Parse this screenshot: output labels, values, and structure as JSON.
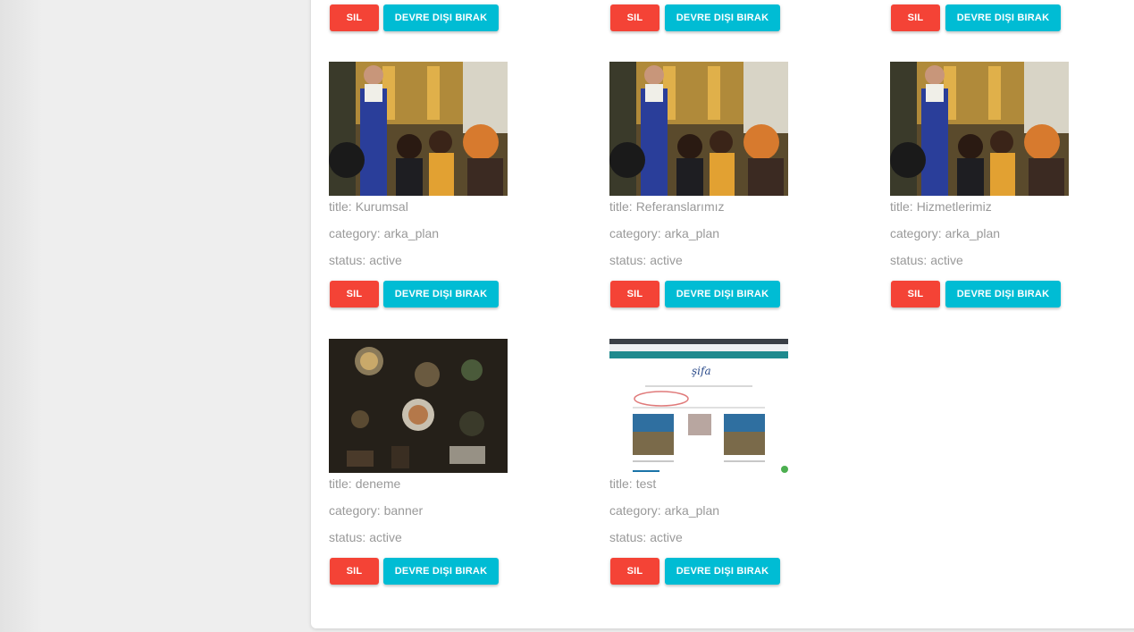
{
  "colors": {
    "danger": "#f44336",
    "info": "#00bcd4",
    "meta_text": "#999999"
  },
  "labels": {
    "title": "title:",
    "category": "category:",
    "status": "status:",
    "delete": "SIL",
    "deactivate": "DEVRE DIŞI BIRAK"
  },
  "top_row": [
    {
      "delete": "SIL",
      "deactivate": "DEVRE DIŞI BIRAK"
    },
    {
      "delete": "SIL",
      "deactivate": "DEVRE DIŞI BIRAK"
    },
    {
      "delete": "SIL",
      "deactivate": "DEVRE DIŞI BIRAK"
    }
  ],
  "items": [
    {
      "image": "restaurant-waiter-photo",
      "title": "Kurumsal",
      "category": "arka_plan",
      "status": "active"
    },
    {
      "image": "restaurant-waiter-photo",
      "title": "Referanslarımız",
      "category": "arka_plan",
      "status": "active"
    },
    {
      "image": "restaurant-waiter-photo",
      "title": "Hizmetlerimiz",
      "category": "arka_plan",
      "status": "active"
    },
    {
      "image": "dining-table-food-photo",
      "title": "deneme",
      "category": "banner",
      "status": "active"
    },
    {
      "image": "website-screenshot",
      "title": "test",
      "category": "arka_plan",
      "status": "active"
    }
  ]
}
